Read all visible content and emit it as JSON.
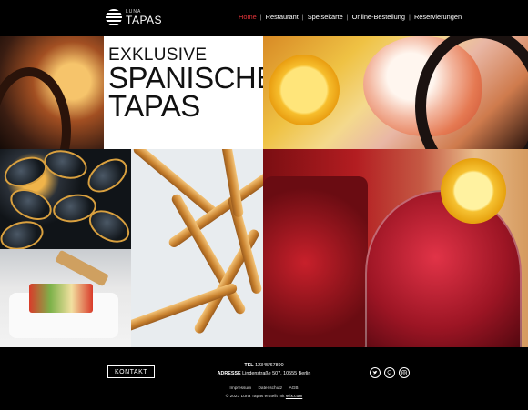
{
  "brand": {
    "small": "LUNA",
    "big": "TAPAS"
  },
  "nav": {
    "items": [
      {
        "label": "Home",
        "active": true
      },
      {
        "label": "Restaurant",
        "active": false
      },
      {
        "label": "Speisekarte",
        "active": false
      },
      {
        "label": "Online-Bestellung",
        "active": false
      },
      {
        "label": "Reservierungen",
        "active": false
      }
    ]
  },
  "hero": {
    "line1": "EXKLUSIVE",
    "line2": "SPANISCHE",
    "line3": "TAPAS"
  },
  "footer": {
    "button": "KONTAKT",
    "tel_label": "TEL",
    "tel_value": "12345/67890",
    "address_label": "ADRESSE",
    "address_value": "Lindenstraße 507, 10555 Berlin",
    "links": [
      "Impressum",
      "Datenschutz",
      "AGB"
    ],
    "copyright_text": "© 2023 Luna Tapas erstellt mit",
    "copyright_link": "Wix.com"
  },
  "social": {
    "twitter": "twitter-icon",
    "pinterest": "pinterest-icon",
    "instagram": "instagram-icon"
  },
  "colors": {
    "accent": "#e4353a",
    "background": "#000000"
  }
}
